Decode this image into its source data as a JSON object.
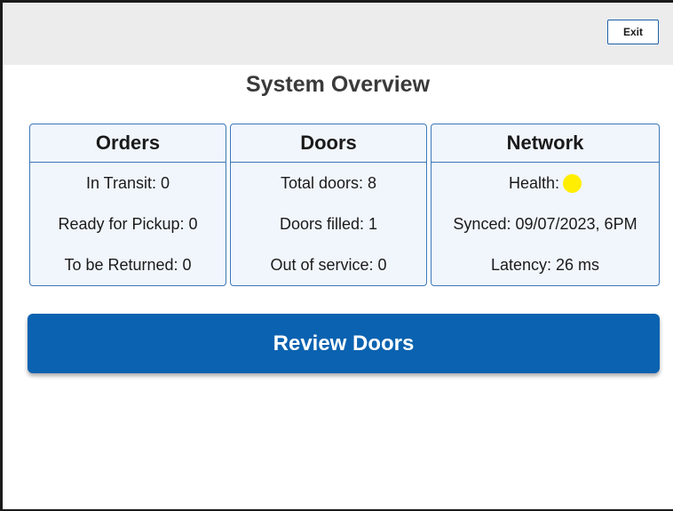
{
  "header": {
    "exit_label": "Exit"
  },
  "page": {
    "title": "System Overview"
  },
  "cards": {
    "orders": {
      "title": "Orders",
      "rows": [
        "In Transit: 0",
        "Ready for Pickup: 0",
        "To be Returned: 0"
      ]
    },
    "doors": {
      "title": "Doors",
      "rows": [
        "Total doors: 8",
        "Doors filled: 1",
        "Out of service: 0"
      ]
    },
    "network": {
      "title": "Network",
      "health_label": "Health:",
      "health_status_color": "#ffee00",
      "synced": "Synced: 09/07/2023, 6PM",
      "latency": "Latency: 26 ms"
    }
  },
  "actions": {
    "review_doors_label": "Review Doors"
  },
  "colors": {
    "accent": "#0a62b0",
    "card_border": "#3b78b8",
    "card_background": "#f1f6fc"
  }
}
